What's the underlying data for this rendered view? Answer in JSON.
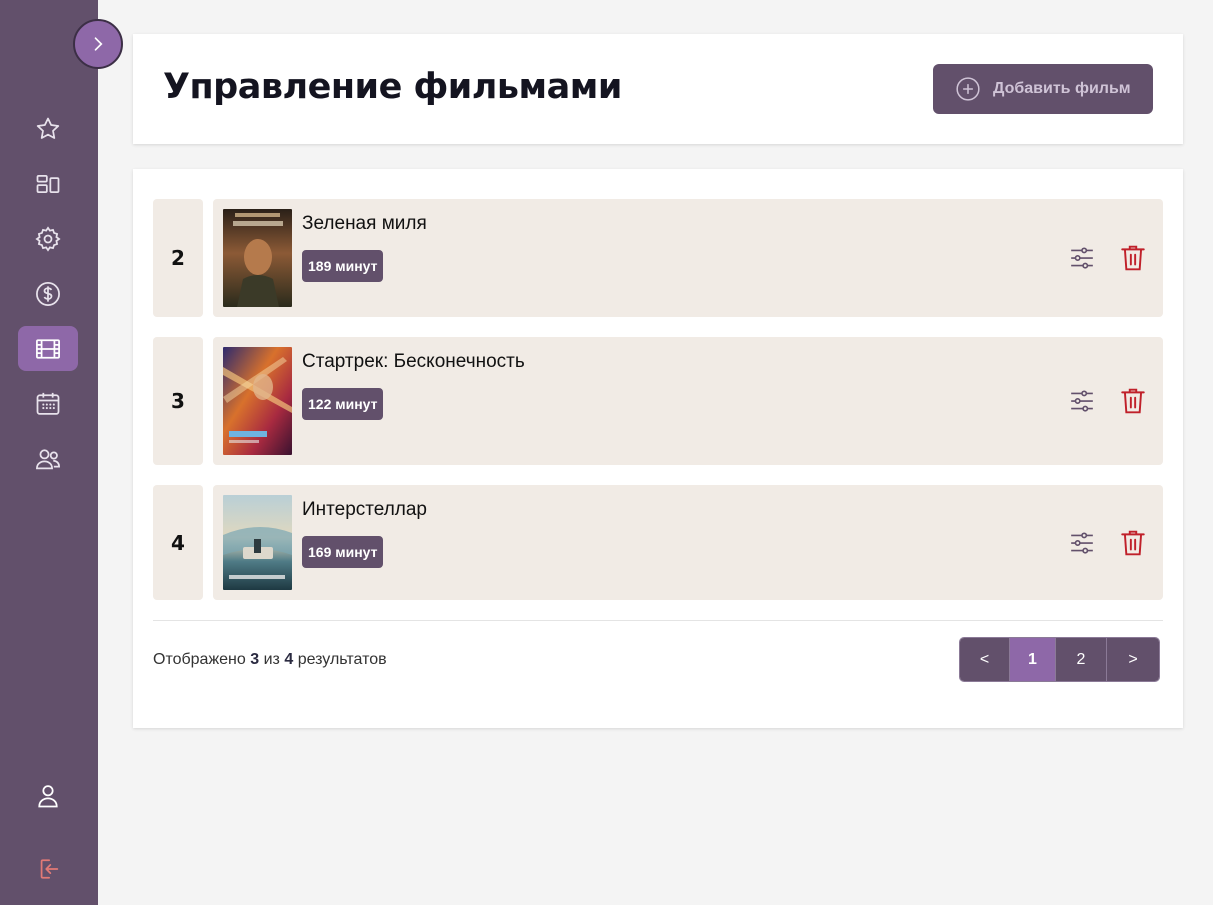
{
  "sidebar": {
    "toggle_icon": "chevron-right-icon",
    "items": [
      {
        "name": "favorites",
        "icon": "star-icon",
        "active": false
      },
      {
        "name": "dashboard",
        "icon": "layout-icon",
        "active": false
      },
      {
        "name": "settings",
        "icon": "gear-icon",
        "active": false
      },
      {
        "name": "finance",
        "icon": "dollar-icon",
        "active": false
      },
      {
        "name": "films",
        "icon": "film-icon",
        "active": true
      },
      {
        "name": "schedule",
        "icon": "calendar-icon",
        "active": false
      },
      {
        "name": "users",
        "icon": "users-icon",
        "active": false
      }
    ],
    "bottom": [
      {
        "name": "profile",
        "icon": "user-icon"
      },
      {
        "name": "logout",
        "icon": "logout-icon"
      }
    ]
  },
  "header": {
    "title": "Управление фильмами",
    "add_button_label": "Добавить фильм",
    "add_button_icon": "plus-circle-icon"
  },
  "films": [
    {
      "number": "2",
      "title": "Зеленая миля",
      "duration": "189 минут"
    },
    {
      "number": "3",
      "title": "Стартрек: Бесконечность",
      "duration": "122 минут"
    },
    {
      "number": "4",
      "title": "Интерстеллар",
      "duration": "169 минут"
    }
  ],
  "footer": {
    "results_prefix": "Отображено",
    "shown": "3",
    "of": "из",
    "total": "4",
    "results_suffix": "результатов"
  },
  "pagination": {
    "prev": "<",
    "pages": [
      "1",
      "2"
    ],
    "current": "1",
    "next": ">"
  },
  "colors": {
    "sidebar": "#62506b",
    "accent": "#8e68a8",
    "row_bg": "#f1ebe5",
    "delete": "#c0202a"
  }
}
